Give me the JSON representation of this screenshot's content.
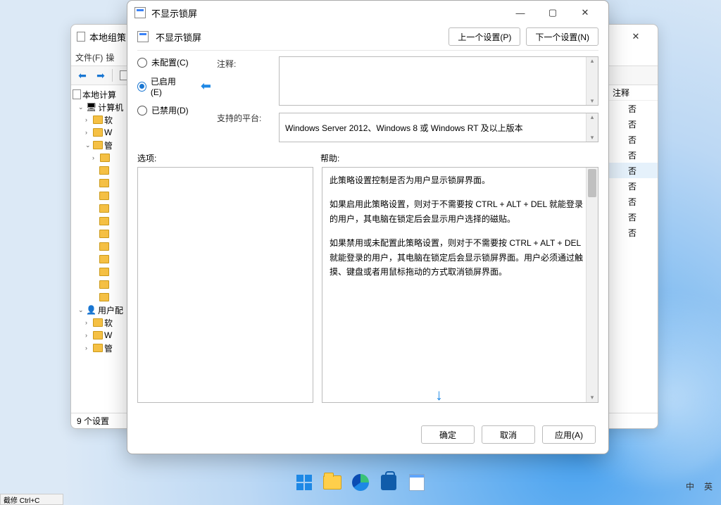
{
  "back_window": {
    "title": "本地组策",
    "menu": {
      "file": "文件(F)",
      "action": "操"
    },
    "tree": {
      "root": "本地计算",
      "computer": "计算机",
      "soft1": "软",
      "win1": "W",
      "admin1": "管",
      "user": "用户配",
      "soft2": "软",
      "win2": "W",
      "admin2": "管"
    },
    "col_note": "注释",
    "row_value": "否",
    "status": "9 个设置"
  },
  "dialog": {
    "title": "不显示锁屏",
    "subtitle": "不显示锁屏",
    "prev_btn": "上一个设置(P)",
    "next_btn": "下一个设置(N)",
    "radio_notconf": "未配置(C)",
    "radio_enabled": "已启用(E)",
    "radio_disabled": "已禁用(D)",
    "label_comment": "注释:",
    "label_supported": "支持的平台:",
    "supported_text": "Windows Server 2012、Windows 8 或 Windows RT 及以上版本",
    "label_options": "选项:",
    "label_help": "帮助:",
    "help_p1": "此策略设置控制是否为用户显示锁屏界面。",
    "help_p2": "如果启用此策略设置，则对于不需要按 CTRL + ALT + DEL  就能登录的用户，其电脑在锁定后会显示用户选择的磁贴。",
    "help_p3": "如果禁用或未配置此策略设置，则对于不需要按 CTRL + ALT + DEL 就能登录的用户，其电脑在锁定后会显示锁屏界面。用户必须通过触摸、键盘或者用鼠标拖动的方式取消锁屏界面。",
    "btn_ok": "确定",
    "btn_cancel": "取消",
    "btn_apply": "应用(A)"
  },
  "tray": {
    "lang1": "中",
    "lang2": "英"
  },
  "snip": "截修 Ctrl+C"
}
